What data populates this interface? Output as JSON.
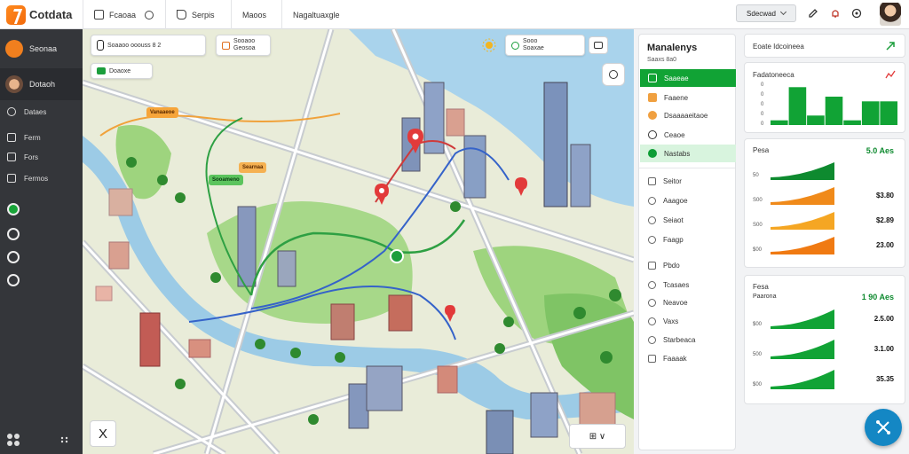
{
  "app": {
    "title": "Cotdata"
  },
  "topbar": {
    "nav": [
      "Fcaoaa",
      "Serpis",
      "Maoos",
      "Nagaltuaxgle"
    ],
    "search_label": "Sdecwad",
    "icons": [
      "pencil-icon",
      "bell-icon",
      "settings-icon"
    ]
  },
  "sidebar": {
    "card1": "Seonaa",
    "card2": "Dotaoh",
    "items": [
      "Dataes",
      "Ferm",
      "Fors",
      "Fermos"
    ]
  },
  "map": {
    "chips": [
      {
        "line1": "Soaaoo ooouss 8 2",
        "line2": ""
      },
      {
        "line1": "Sooaoo",
        "line2": "Geosoa"
      },
      {
        "line1": "Sooo",
        "line2": "Soaxae"
      }
    ],
    "chip_small": "Doaoxe",
    "tags": [
      "Vanaaeoe",
      "Searnaa",
      "Sooameno"
    ],
    "close_label": "X",
    "zoom_label": "⊞ ∨"
  },
  "layers": {
    "title": "Manalenys",
    "subtitle": "Saaxs 8a0",
    "items": [
      {
        "label": "Saaeae",
        "state": "active",
        "color": "#ffffff"
      },
      {
        "label": "Faaene",
        "state": "normal",
        "color": "#f0a040"
      },
      {
        "label": "Dsaaaaeitaoe",
        "state": "normal",
        "color": "#f0a040"
      },
      {
        "label": "Ceaoe",
        "state": "normal",
        "color": "#ffffff"
      },
      {
        "label": "Nastabs",
        "state": "soft",
        "color": "#0d9d35"
      }
    ],
    "options": [
      "Seitor",
      "Aaagoe",
      "Seiaot",
      "Faagp",
      "Pbdo",
      "Tcasaes",
      "Neavoe",
      "Vaxs",
      "Starbeaca",
      "Faaaak"
    ]
  },
  "analytics": {
    "card1": {
      "title": "Eoate Idcoineea",
      "icon": "expand-icon"
    },
    "card2": {
      "title": "Fadatoneeca",
      "y_labels": [
        "0",
        "0",
        "0",
        "0",
        "0"
      ]
    },
    "card3": {
      "title": "Pesa",
      "value": "5.0 Aes",
      "rows": [
        {
          "label": "50",
          "value": "",
          "color": "#0e8a2f"
        },
        {
          "label": "S00",
          "value": "$3.80",
          "color": "#f08a1a"
        },
        {
          "label": "S00",
          "value": "$2.89",
          "color": "#f5a623"
        },
        {
          "label": "$00",
          "value": "23.00",
          "color": "#f07a12"
        }
      ]
    },
    "card4": {
      "title": "Fesa",
      "subtitle": "Paarona",
      "value": "1 90 Aes",
      "rows": [
        {
          "label": "$00",
          "value": "2.5.00",
          "color": "#11a335"
        },
        {
          "label": "500",
          "value": "3.1.00",
          "color": "#11a335"
        },
        {
          "label": "$00",
          "value": "35.35",
          "color": "#11a335"
        }
      ]
    }
  },
  "chart_data": {
    "type": "bar",
    "values": [
      1,
      8,
      2,
      6,
      1,
      5,
      5
    ],
    "ylim": [
      0,
      9
    ]
  }
}
